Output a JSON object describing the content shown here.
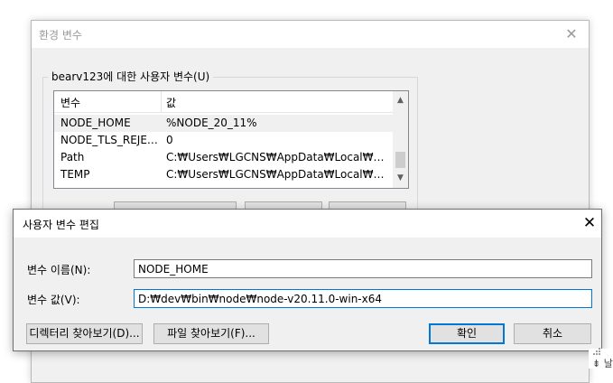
{
  "env_window": {
    "title": "환경 변수",
    "group_label": "bearv123에 대한 사용자 변수(U)",
    "list": {
      "columns": [
        "변수",
        "값"
      ],
      "rows": [
        {
          "name": "NODE_HOME",
          "value": "%NODE_20_11%",
          "selected": true
        },
        {
          "name": "NODE_TLS_REJECT...",
          "value": "0",
          "selected": false
        },
        {
          "name": "Path",
          "value": "C:₩Users₩LGCNS₩AppData₩Local₩Micros...",
          "selected": false
        },
        {
          "name": "TEMP",
          "value": "C:₩Users₩LGCNS₩AppData₩Local₩Temp",
          "selected": false
        }
      ]
    }
  },
  "edit_dialog": {
    "title": "사용자 변수 편집",
    "name_label": "변수 이름(N):",
    "name_value": "NODE_HOME",
    "value_label": "변수 값(V):",
    "value_value": "D:₩dev₩bin₩node₩node-v20.11.0-win-x64",
    "browse_dir_label": "디렉터리 찾아보기(D)...",
    "browse_file_label": "파일 찾아보기(F)...",
    "ok_label": "확인",
    "cancel_label": "취소"
  },
  "corner": {
    "text": "⇟ 날짜"
  },
  "colors": {
    "accent": "#0078d7",
    "dialog_bg": "#f0f0f0",
    "button_bg": "#e1e1e1"
  },
  "icons": {
    "close": "close-icon",
    "scroll_up": "chevron-up-icon",
    "scroll_down": "chevron-down-icon"
  }
}
